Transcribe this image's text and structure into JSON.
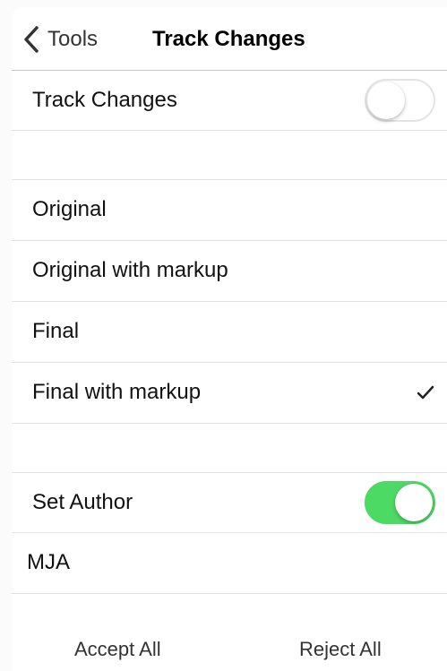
{
  "nav": {
    "back_label": "Tools",
    "title": "Track Changes"
  },
  "track_changes": {
    "label": "Track Changes",
    "enabled": false
  },
  "view_options": [
    {
      "label": "Original",
      "selected": false
    },
    {
      "label": "Original with markup",
      "selected": false
    },
    {
      "label": "Final",
      "selected": false
    },
    {
      "label": "Final with markup",
      "selected": true
    }
  ],
  "author": {
    "label": "Set Author",
    "enabled": true,
    "name": "MJA"
  },
  "actions": {
    "accept_all": "Accept All",
    "reject_all": "Reject All"
  },
  "colors": {
    "toggle_on": "#4cd964",
    "separator": "#e2e2e6"
  },
  "icons": {
    "back": "chevron-left-icon",
    "selected": "checkmark-icon"
  }
}
